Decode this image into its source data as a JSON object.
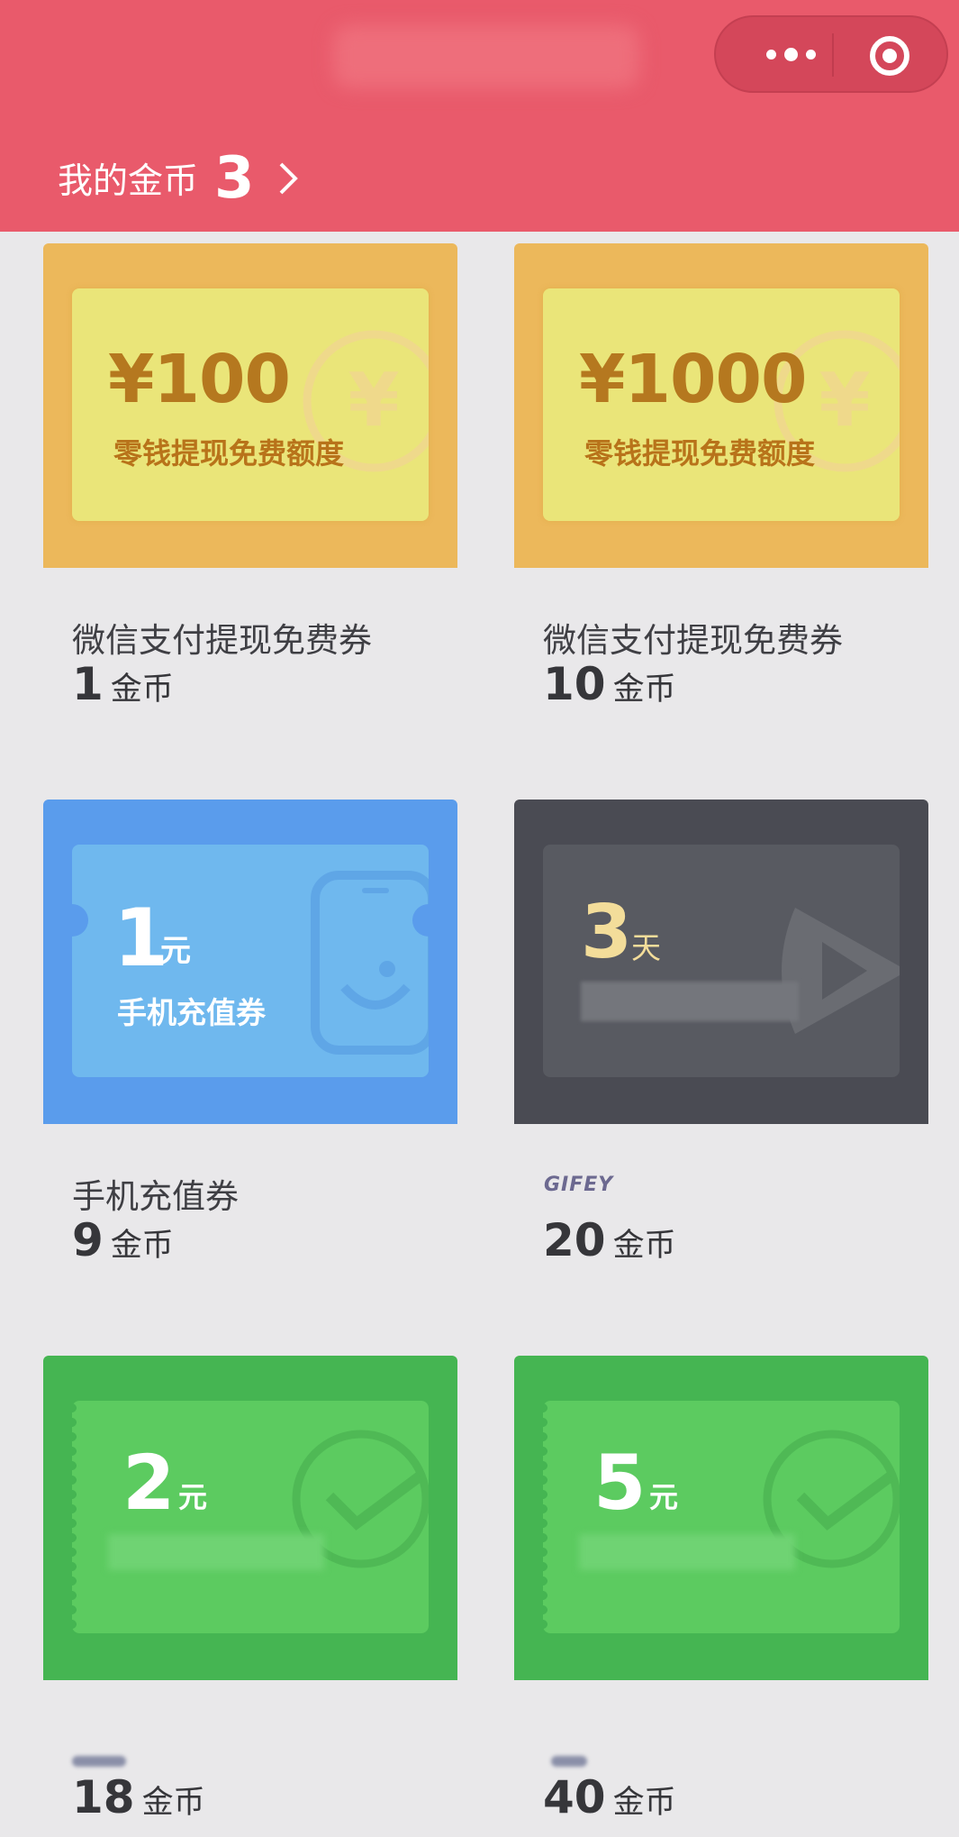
{
  "header": {
    "coins_label": "我的金币",
    "coins_count": "3"
  },
  "capsule": {
    "more_icon": "more-dots-icon",
    "close_icon": "target-circle-icon"
  },
  "colors": {
    "header": "#e95a6b",
    "gold_card": "#ecb85b",
    "blue_card": "#5a9cec",
    "dark_card": "#4a4b53",
    "green_card": "#45b552"
  },
  "items": [
    {
      "ticket_amount": "¥100",
      "ticket_sub": "零钱提现免费额度",
      "name": "微信支付提现免费券",
      "price": "1",
      "price_unit": "金币"
    },
    {
      "ticket_amount": "¥1000",
      "ticket_sub": "零钱提现免费额度",
      "name": "微信支付提现免费券",
      "price": "10",
      "price_unit": "金币"
    },
    {
      "ticket_num": "1",
      "ticket_unit": "元",
      "ticket_sub": "手机充值券",
      "name": "手机充值券",
      "price": "9",
      "price_unit": "金币"
    },
    {
      "ticket_num": "3",
      "ticket_unit": "天",
      "name": "GIFEY",
      "price": "20",
      "price_unit": "金币"
    },
    {
      "ticket_num": "2",
      "ticket_unit": "元",
      "price": "18",
      "price_unit": "金币"
    },
    {
      "ticket_num": "5",
      "ticket_unit": "元",
      "price": "40",
      "price_unit": "金币"
    }
  ]
}
